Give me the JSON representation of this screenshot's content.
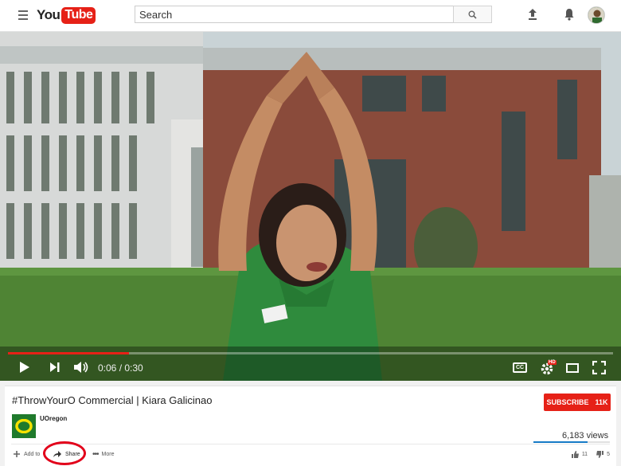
{
  "header": {
    "logo_you": "You",
    "logo_tube": "Tube",
    "search_placeholder": "Search"
  },
  "player": {
    "time_current": "0:06",
    "time_total": "0:30",
    "time_display": "0:06 / 0:30",
    "progress_fraction": 0.2,
    "cc_label": "CC",
    "hd_badge": "HD"
  },
  "video": {
    "title": "#ThrowYourO Commercial | Kiara Galicinao",
    "channel": "UOregon",
    "channel_logo_letter": "O",
    "subscribe_label": "SUBSCRIBE",
    "subscriber_count": "11K",
    "views": "6,183 views",
    "likes": "11",
    "dislikes": "5"
  },
  "actions": {
    "add_to": "Add to",
    "share": "Share",
    "more": "More"
  },
  "colors": {
    "brand_red": "#e62117",
    "oregon_green": "#1f7a2c",
    "annotation_red": "#e2001a"
  }
}
